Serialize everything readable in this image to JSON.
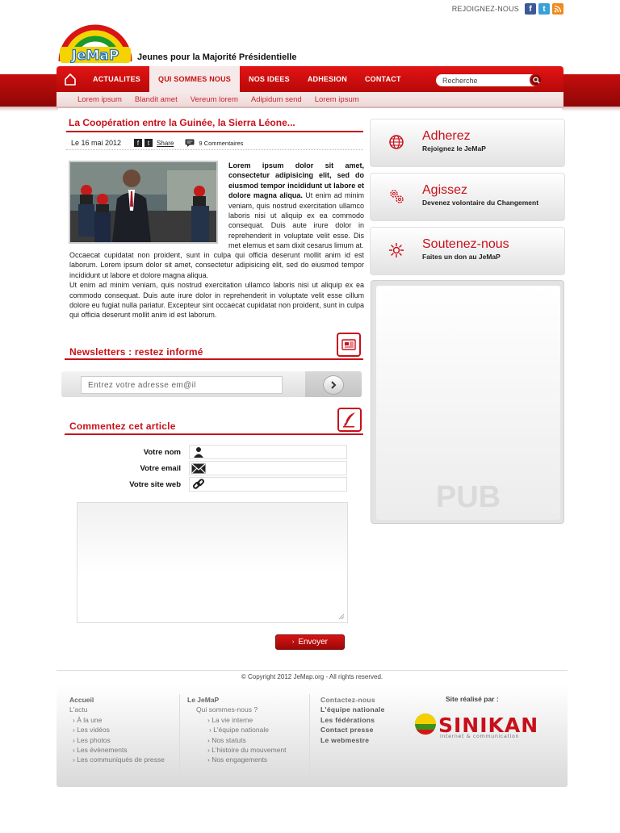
{
  "header": {
    "join_label": "REJOIGNEZ-NOUS",
    "social_icons": [
      "facebook-icon",
      "twitter-icon",
      "rss-icon"
    ],
    "logo_text": "JeMaP",
    "tagline": "Jeunes pour la Majorité Présidentielle"
  },
  "nav": {
    "items": [
      {
        "label": "ACTUALITES",
        "active": false
      },
      {
        "label": "QUI SOMMES NOUS",
        "active": true
      },
      {
        "label": "NOS IDEES",
        "active": false
      },
      {
        "label": "ADHESION",
        "active": false
      },
      {
        "label": "CONTACT",
        "active": false
      }
    ],
    "search_placeholder": "Recherche"
  },
  "subnav": [
    "Lorem ipsum",
    "Blandit amet",
    "Vereum lorem",
    "Adipidum send",
    "Lorem ipsum"
  ],
  "article": {
    "title": "La Coopération entre la Guinée, la Sierra Léone...",
    "date": "Le 16 mai 2012",
    "share_label": "Share",
    "comments": "9 Commentaires",
    "lead_bold": "Lorem ipsum dolor sit amet, consectetur adipisicing elit, sed do eiusmod tempor incididunt ut labore et dolore magna aliqua.",
    "lead_rest": " Ut enim ad minim veniam, quis nostrud exercitation ullamco laboris nisi ut aliquip ex ea commodo consequat. Duis aute irure dolor in reprehenderit in voluptate velit esse. Dis met elemus et sam dixit cesarus limum at.",
    "para1": "Occaecat cupidatat non proident, sunt in culpa qui officia deserunt mollit anim id est laborum. Lorem ipsum dolor sit amet, consectetur adipisicing elit, sed do eiusmod tempor incididunt ut labore et dolore magna aliqua.",
    "para2": " Ut enim ad minim veniam, quis nostrud exercitation ullamco laboris nisi ut aliquip ex ea commodo consequat. Duis aute irure dolor in reprehenderit in voluptate velit esse cillum dolore eu fugiat nulla pariatur. Excepteur sint occaecat cupidatat non proident, sunt in culpa qui officia deserunt mollit anim id est laborum."
  },
  "newsletter": {
    "title": "Newsletters : restez informé",
    "placeholder": "Entrez votre adresse em@il"
  },
  "comment_form": {
    "title": "Commentez cet article",
    "name_label": "Votre nom",
    "email_label": "Votre email",
    "site_label": "Votre site web",
    "send_label": "Envoyer"
  },
  "actions": [
    {
      "title": "Adherez",
      "subtitle": "Rejoignez le JeMaP",
      "icon": "globe-icon"
    },
    {
      "title": "Agissez",
      "subtitle": "Devenez volontaire du Changement",
      "icon": "gears-icon"
    },
    {
      "title": "Soutenez-nous",
      "subtitle": "Faites un don au JeMaP",
      "icon": "sun-icon"
    }
  ],
  "pub_label": "PUB",
  "footer": {
    "copyright": "© Copyright 2012 JeMap.org - All rights reserved.",
    "col1": {
      "heading": "Accueil",
      "items": [
        "L'actu",
        "› À la une",
        "› Les vidéos",
        "› Les photos",
        "› Les évènements",
        "› Les communiqués de presse"
      ]
    },
    "col2": {
      "heading": "Le JeMaP",
      "items": [
        "Qui sommes-nous ?",
        "› La vie interne",
        "› L'équipe nationale",
        "› Nos statuts",
        "› L'histoire du mouvement",
        "› Nos engagements"
      ]
    },
    "col3": {
      "heading": "Contactez-nous",
      "items": [
        "L'équipe nationale",
        "Les fédérations",
        "Contact presse",
        "Le webmestre"
      ]
    },
    "credit_label": "Site réalisé par :",
    "credit_name": "SINIKAN",
    "credit_tagline": "internet & communication"
  },
  "colors": {
    "brand_red": "#c8101a",
    "nav_red": "#e31414",
    "subnav_text": "#c8232c"
  }
}
